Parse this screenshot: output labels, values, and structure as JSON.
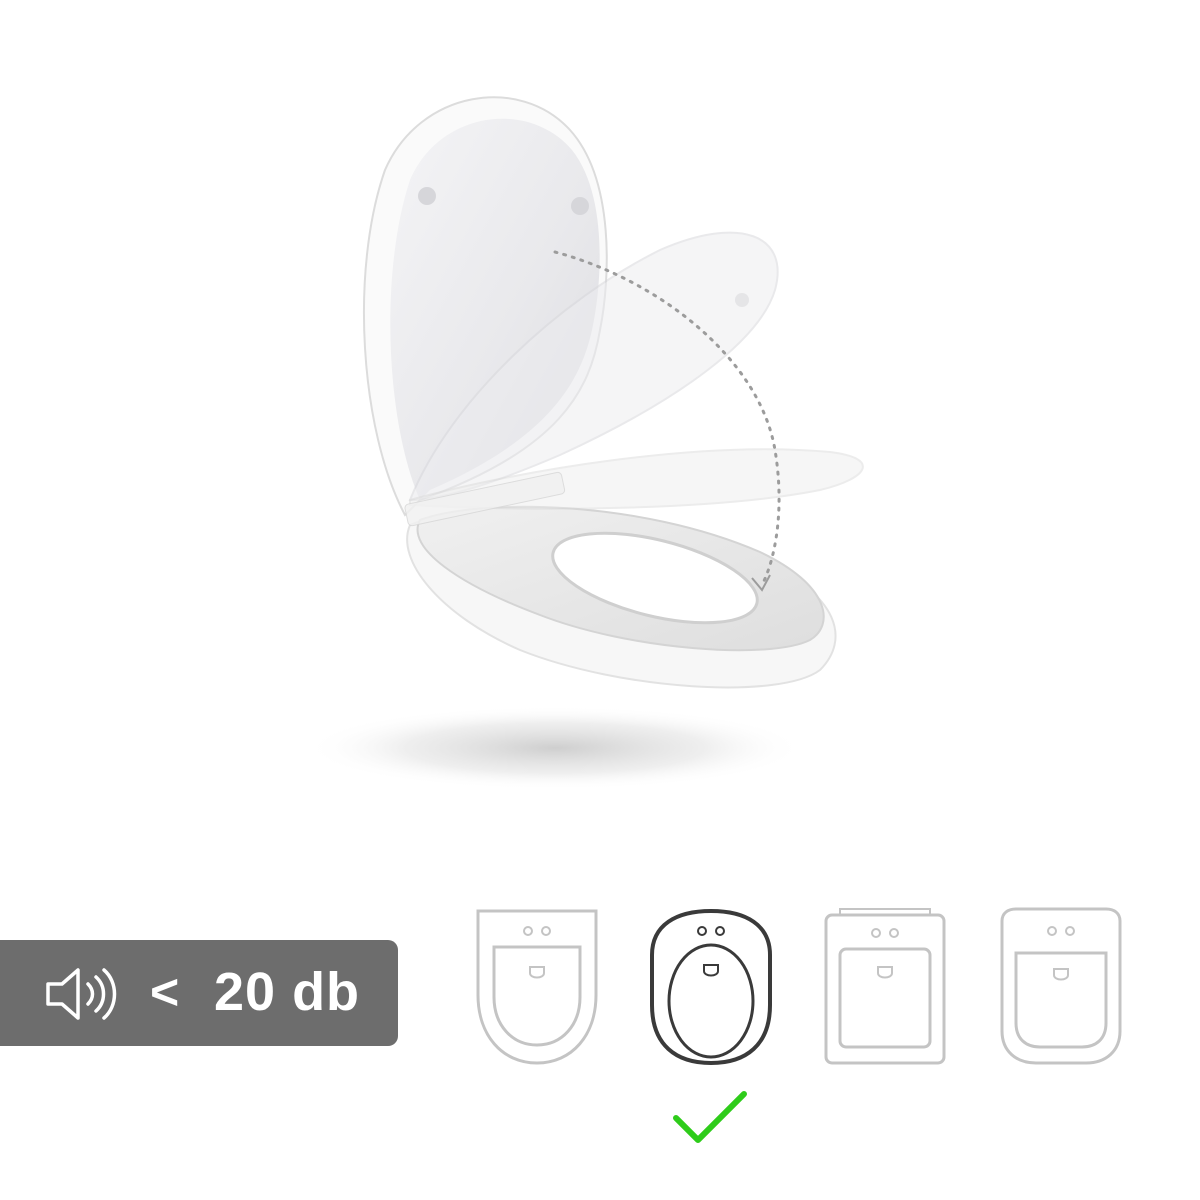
{
  "noise_badge": {
    "icon": "speaker-sound-icon",
    "symbol": "<",
    "value": "20 db",
    "background_color": "#6d6d6d",
    "text_color": "#ffffff"
  },
  "compatibility": {
    "shapes": [
      {
        "icon": "round-d-shape-toilet-icon",
        "selected": false
      },
      {
        "icon": "oval-shape-toilet-icon",
        "selected": true
      },
      {
        "icon": "square-shape-toilet-icon",
        "selected": false
      },
      {
        "icon": "rounded-square-shape-toilet-icon",
        "selected": false
      }
    ],
    "selected_icon": "green-checkmark-icon",
    "selected_color": "#2ecc1a",
    "outline_color_inactive": "#c4c4c4",
    "outline_color_active": "#3a3a3a"
  },
  "product_image": {
    "icon": "toilet-seat-soft-close-illustration"
  }
}
